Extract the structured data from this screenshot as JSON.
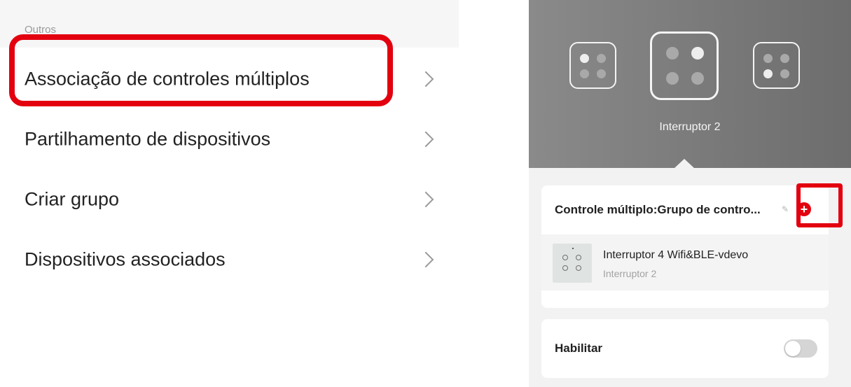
{
  "left": {
    "section_header": "Outros",
    "items": [
      {
        "label": "Associação de controles múltiplos"
      },
      {
        "label": "Partilhamento de dispositivos"
      },
      {
        "label": "Criar grupo"
      },
      {
        "label": "Dispositivos associados"
      }
    ],
    "chevron_icon": "chevron-right-icon",
    "highlight_color": "#e3000f"
  },
  "right": {
    "hero": {
      "selected_switch_label": "Interruptor 2"
    },
    "multi_control": {
      "title": "Controle múltiplo:Grupo de contro...",
      "add_icon": "plus-circle-icon",
      "device": {
        "name": "Interruptor 4 Wifi&BLE-vdevo",
        "sub": "Interruptor 2"
      }
    },
    "enable": {
      "label": "Habilitar",
      "state": "off"
    },
    "accent_color": "#e3000f"
  }
}
